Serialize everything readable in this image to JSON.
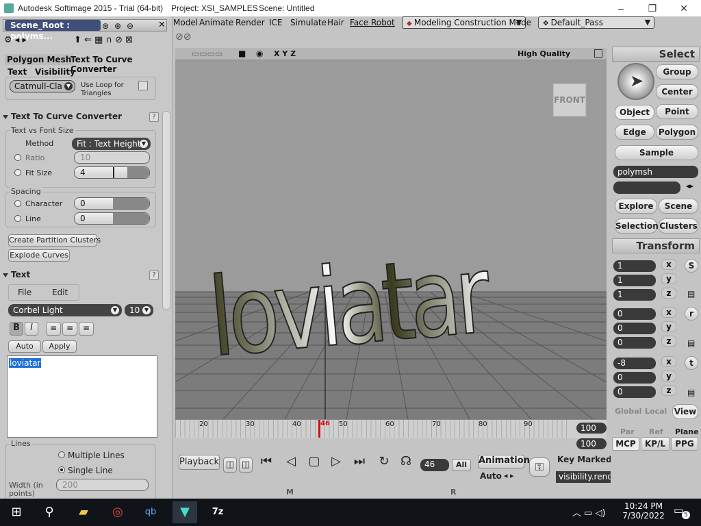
{
  "titlebar": {
    "app": "Autodesk Softimage 2015 - Trial (64-bit)",
    "project": "Project: XSI_SAMPLES",
    "scene": "Scene: Untitled",
    "minimize": "–",
    "maximize": "❐",
    "close": "✕"
  },
  "menubar": {
    "items": [
      "Model",
      "Animate",
      "Render",
      "ICE",
      "Simulate",
      "Hair",
      "Face Robot"
    ],
    "mode": "Modeling Construction Mode",
    "pass": "Default_Pass"
  },
  "ppg": {
    "title": "Scene_Root : polyms...",
    "close": "✕",
    "tabs": [
      "Polygon Mesh",
      "Text To Curve Converter",
      "Text",
      "Visibility"
    ],
    "subdiv_value": "Catmull-Cla",
    "use_loop_label": "Use Loop for Triangles",
    "section_converter": "Text To Curve Converter",
    "group_fontsize": "Text vs Font Size",
    "method_label": "Method",
    "method_value": "Fit : Text Height",
    "ratio_label": "Ratio",
    "ratio_value": "10",
    "fitsize_label": "Fit Size",
    "fitsize_value": "4",
    "group_spacing": "Spacing",
    "character_label": "Character",
    "character_value": "0",
    "line_label": "Line",
    "line_value": "0",
    "create_partition": "Create Partition Clusters",
    "explode_curves": "Explode Curves",
    "section_text": "Text",
    "file_menu": "File",
    "edit_menu": "Edit",
    "font_name": "Corbel Light",
    "font_size": "10",
    "bold": "B",
    "italic": "I",
    "auto": "Auto",
    "apply": "Apply",
    "text_content": "loviatar",
    "group_lines": "Lines",
    "multiple_lines": "Multiple Lines",
    "single_line": "Single Line",
    "width_label": "Width (in points)",
    "width_value": "200",
    "help": "?"
  },
  "viewport": {
    "axes": "X Y Z",
    "quality": "High Quality",
    "view_cube": "FRONT",
    "text3d": "loviatar"
  },
  "timeline": {
    "ticks": [
      "20",
      "30",
      "40",
      "50",
      "60",
      "70",
      "80",
      "90"
    ],
    "current": "46",
    "end1": "100",
    "end2": "100",
    "start2": "100"
  },
  "playback": {
    "label": "Playback",
    "frame": "46",
    "all": "All",
    "animation": "Animation",
    "auto": "Auto",
    "key_marked": "Key Marked Parameters",
    "param": "visibility.rendvis",
    "m_label": "M",
    "r_label": "R"
  },
  "select_panel": {
    "title": "Select",
    "group": "Group",
    "center": "Center",
    "object": "Object",
    "point": "Point",
    "edge": "Edge",
    "polygon": "Polygon",
    "sample": "Sample",
    "name_field": "polymsh",
    "explore": "Explore",
    "scene": "Scene",
    "selection": "Selection",
    "clusters": "Clusters"
  },
  "transform_panel": {
    "title": "Transform",
    "scale": [
      "1",
      "1",
      "1"
    ],
    "rotate": [
      "0",
      "0",
      "0"
    ],
    "translate": [
      "-8",
      "0",
      "0"
    ],
    "x": "x",
    "y": "y",
    "z": "z",
    "s": "S",
    "r": "r",
    "t": "t",
    "global": "Global",
    "local": "Local",
    "view": "View",
    "par": "Par",
    "ref": "Ref",
    "plane": "Plane",
    "mcp": "MCP",
    "kpl": "KP/L",
    "ppg": "PPG"
  },
  "taskbar": {
    "time": "10:24 PM",
    "date": "7/30/2022",
    "notif_count": "5"
  },
  "colors": {
    "panel_bg": "#c8c8c8",
    "viewport_bg": "#9b9b9b",
    "accent_red": "#cc1111",
    "highlight": "#1e6fd9"
  }
}
